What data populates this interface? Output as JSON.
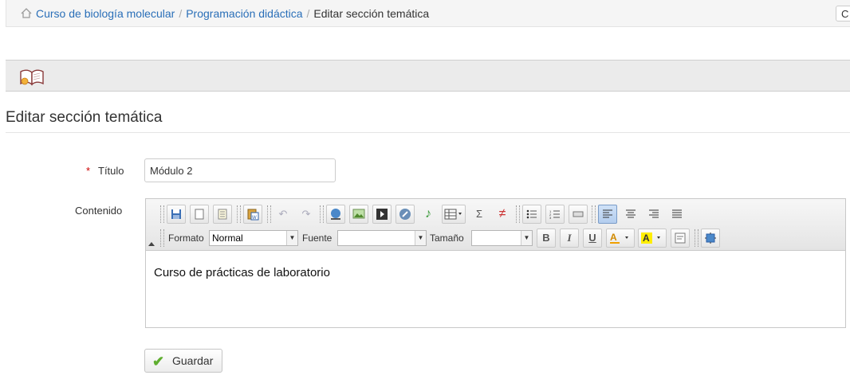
{
  "breadcrumb": {
    "items": [
      "Curso de biología molecular",
      "Programación didáctica"
    ],
    "current": "Editar sección temática",
    "separator": "/"
  },
  "top_button": {
    "label": "C"
  },
  "page": {
    "title": "Editar sección temática"
  },
  "form": {
    "required_mark": "*",
    "titulo_label": "Título",
    "titulo_value": "Módulo 2",
    "contenido_label": "Contenido"
  },
  "editor": {
    "format_label": "Formato",
    "format_value": "Normal",
    "font_label": "Fuente",
    "font_value": "",
    "size_label": "Tamaño",
    "size_value": "",
    "content": "Curso de prácticas de laboratorio"
  },
  "save_button": {
    "label": "Guardar"
  },
  "colors": {
    "link": "#2a6fb8",
    "accent_check": "#5fae2f",
    "required": "#cc0000"
  }
}
